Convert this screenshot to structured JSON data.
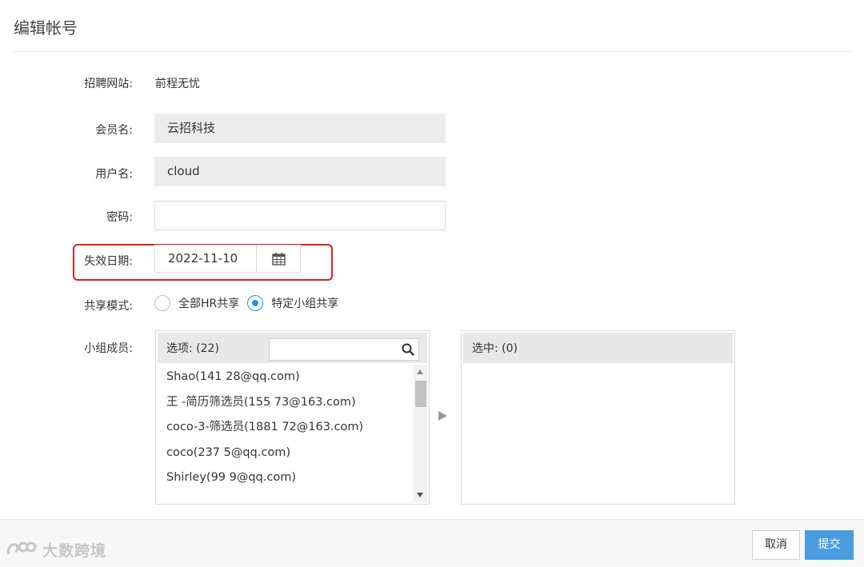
{
  "header": {
    "title": "编辑帐号"
  },
  "form": {
    "site": {
      "label": "招聘网站:",
      "value": "前程无忧"
    },
    "member": {
      "label": "会员名:",
      "value": "云招科技"
    },
    "username": {
      "label": "用户名:",
      "value": "cloud"
    },
    "password": {
      "label": "密码:",
      "value": ""
    },
    "expiry": {
      "label": "失效日期:",
      "value": "2022-11-10",
      "icon": "calendar-icon"
    },
    "share_mode": {
      "label": "共享模式:",
      "options": [
        {
          "label": "全部HR共享",
          "checked": false
        },
        {
          "label": "特定小组共享",
          "checked": true
        }
      ]
    },
    "members": {
      "label": "小组成员:",
      "options_header": "选项: (22)",
      "search_placeholder": "",
      "selected_header": "选中: (0)",
      "options": [
        "Shao(141        28@qq.com)",
        "王    -简历筛选员(155          73@163.com)",
        "coco-3-筛选员(1881     72@163.com)",
        "coco(237       5@qq.com)",
        "Shirley(99        9@qq.com)"
      ]
    }
  },
  "footer": {
    "cancel_label": "取消",
    "submit_label": "提交",
    "watermark": "大数跨境"
  },
  "colors": {
    "accent": "#1e90ff",
    "submit_bg": "#4a9de0",
    "highlight_border": "#e02020"
  }
}
